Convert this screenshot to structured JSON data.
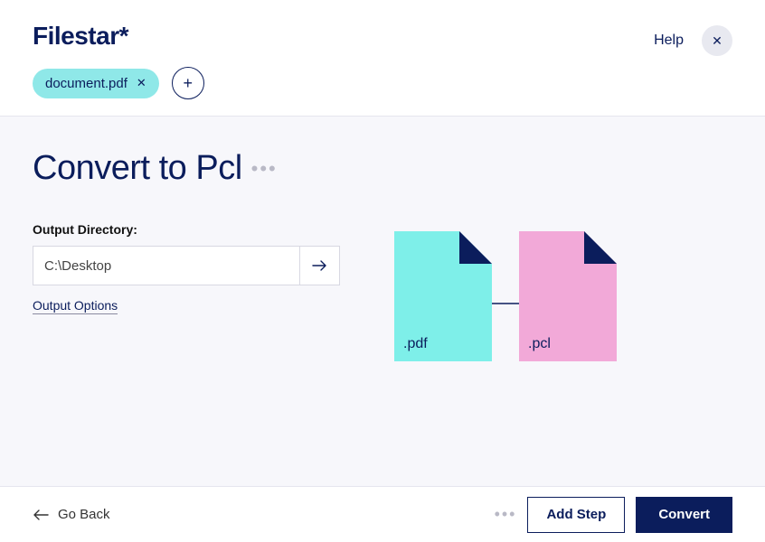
{
  "header": {
    "logo": "Filestar*",
    "file_chip": "document.pdf",
    "help": "Help"
  },
  "main": {
    "title": "Convert to Pcl",
    "output_label": "Output Directory:",
    "output_value": "C:\\Desktop",
    "output_options": "Output Options",
    "src_ext": ".pdf",
    "dst_ext": ".pcl"
  },
  "footer": {
    "go_back": "Go Back",
    "add_step": "Add Step",
    "convert": "Convert"
  }
}
